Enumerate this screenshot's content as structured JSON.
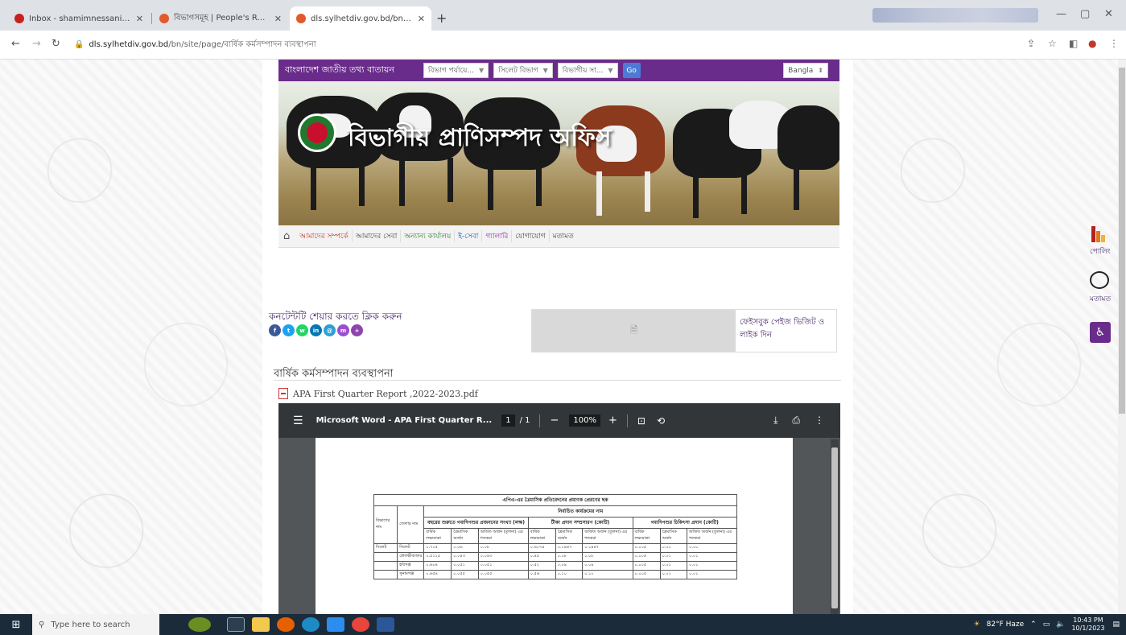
{
  "browser": {
    "tabs": [
      {
        "title": "Inbox - shamimnessanims@gm",
        "favicon_color": "#c5221f"
      },
      {
        "title": "বিভাগসমূহ | People's Republic o",
        "favicon_color": "#e05a2b"
      },
      {
        "title": "dls.sylhetdiv.gov.bd/bn/site/pa",
        "favicon_color": "#e05a2b"
      }
    ],
    "new_tab": "+",
    "url_domain": "dls.sylhetdiv.gov.bd",
    "url_path": "/bn/site/page/বার্ষিক কর্মসম্পাদন ব্যবস্থাপনা"
  },
  "site": {
    "name": "বাংলাদেশ জাতীয় তথ্য বাতায়ন",
    "selects": [
      "বিভাগ পর্যায়ে...",
      "সিলেট বিভাগ",
      "বিভাগীয় সা..."
    ],
    "go": "Go",
    "language": "Bangla",
    "banner_title": "বিভাগীয় প্রাণিসম্পদ অফিস",
    "menu": [
      "আমাদের সম্পর্কে",
      "আমাদের সেবা",
      "অন্যান্য কার্যালয়",
      "ই-সেবা",
      "গ্যালারি",
      "যোগাযোগ",
      "মতামত"
    ]
  },
  "share": {
    "title": "কনটেন্টটি শেয়ার করতে ক্লিক করুন",
    "buttons": [
      {
        "name": "facebook",
        "color": "#3b5998",
        "glyph": "f"
      },
      {
        "name": "twitter",
        "color": "#1da1f2",
        "glyph": "t"
      },
      {
        "name": "whatsapp",
        "color": "#25d366",
        "glyph": "w"
      },
      {
        "name": "linkedin",
        "color": "#0077b5",
        "glyph": "in"
      },
      {
        "name": "email",
        "color": "#2aa1d8",
        "glyph": "@"
      },
      {
        "name": "messenger",
        "color": "#9b4fd0",
        "glyph": "m"
      },
      {
        "name": "share-more",
        "color": "#8e44ad",
        "glyph": "+"
      }
    ]
  },
  "facebook_box": {
    "text": "ফেইসবুক পেইজ ভিজিট ও লাইক দিন"
  },
  "document": {
    "title": "বার্ষিক কর্মসম্পাদন ব্যবস্থাপনা",
    "pdf_link": "APA First Quarter Report ,2022-2023.pdf",
    "viewer": {
      "title": "Microsoft Word - APA First Quarter R...",
      "page": "1",
      "pages": "/ 1",
      "zoom": "100%"
    },
    "table": {
      "caption": "এপিএ-এর ত্রৈমাসিক প্রতিবেদনের প্রমাণক প্রেরণের ছক",
      "header_main": "নির্বাচিত কার্যক্রমের নাম",
      "col_division": "বিভাগের নাম",
      "col_district": "জেলার নাম",
      "groups": [
        "বছরের শুরুতে গবাদিপশুর প্রজননের সংখ্যা (লক্ষ)",
        "টীকা প্রদান সম্প্রসারণ (কোটি)",
        "গবাদিপশুর চিকিৎসা প্রদান (কোটি)"
      ],
      "sub": [
        "বার্ষিক লক্ষ্যমাত্রা",
        "ত্রৈমাসিক অর্জন",
        "অর্জিত অর্জন (তুলনা) এর শতকরা"
      ],
      "division_value": "সিলেট",
      "rows": [
        {
          "district": "সিলেট",
          "values": [
            "০.৭০৫",
            "০.০৬",
            "০.০৮",
            "০.৬০৭৪",
            "০.১৪৪৭",
            "০.১৪৪৭",
            "০.০০৫",
            "০.০১",
            "০.০০"
          ]
        },
        {
          "district": "মৌলভীবাজার",
          "values": [
            "০.৫১২৫",
            "০.০৪৩",
            "০.০৪৩",
            "০.৪৫",
            "০.০৮",
            "০.০৮",
            "০.০০৪",
            "০.০১",
            "০.০১"
          ]
        },
        {
          "district": "হবিগঞ্জ",
          "values": [
            "০.৬০৪",
            "০.০৫১",
            "০.০৫১",
            "০.৫২",
            "০.০৯",
            "০.০৯",
            "০.০০৫",
            "০.০১",
            "০.০১"
          ]
        },
        {
          "district": "সুনামগঞ্জ",
          "values": [
            "০.৬৫৪",
            "০.০৫৫",
            "০.০৫৫",
            "০.৫৬",
            "০.১০",
            "০.১০",
            "০.০০৫",
            "০.০১",
            "০.০১"
          ]
        }
      ]
    }
  },
  "floating": {
    "poll_label": "পোলিং",
    "feedback_label": "মতামত"
  },
  "taskbar": {
    "search_placeholder": "Type here to search",
    "weather": "82°F  Haze",
    "time": "10:43 PM",
    "date": "10/1/2023"
  }
}
